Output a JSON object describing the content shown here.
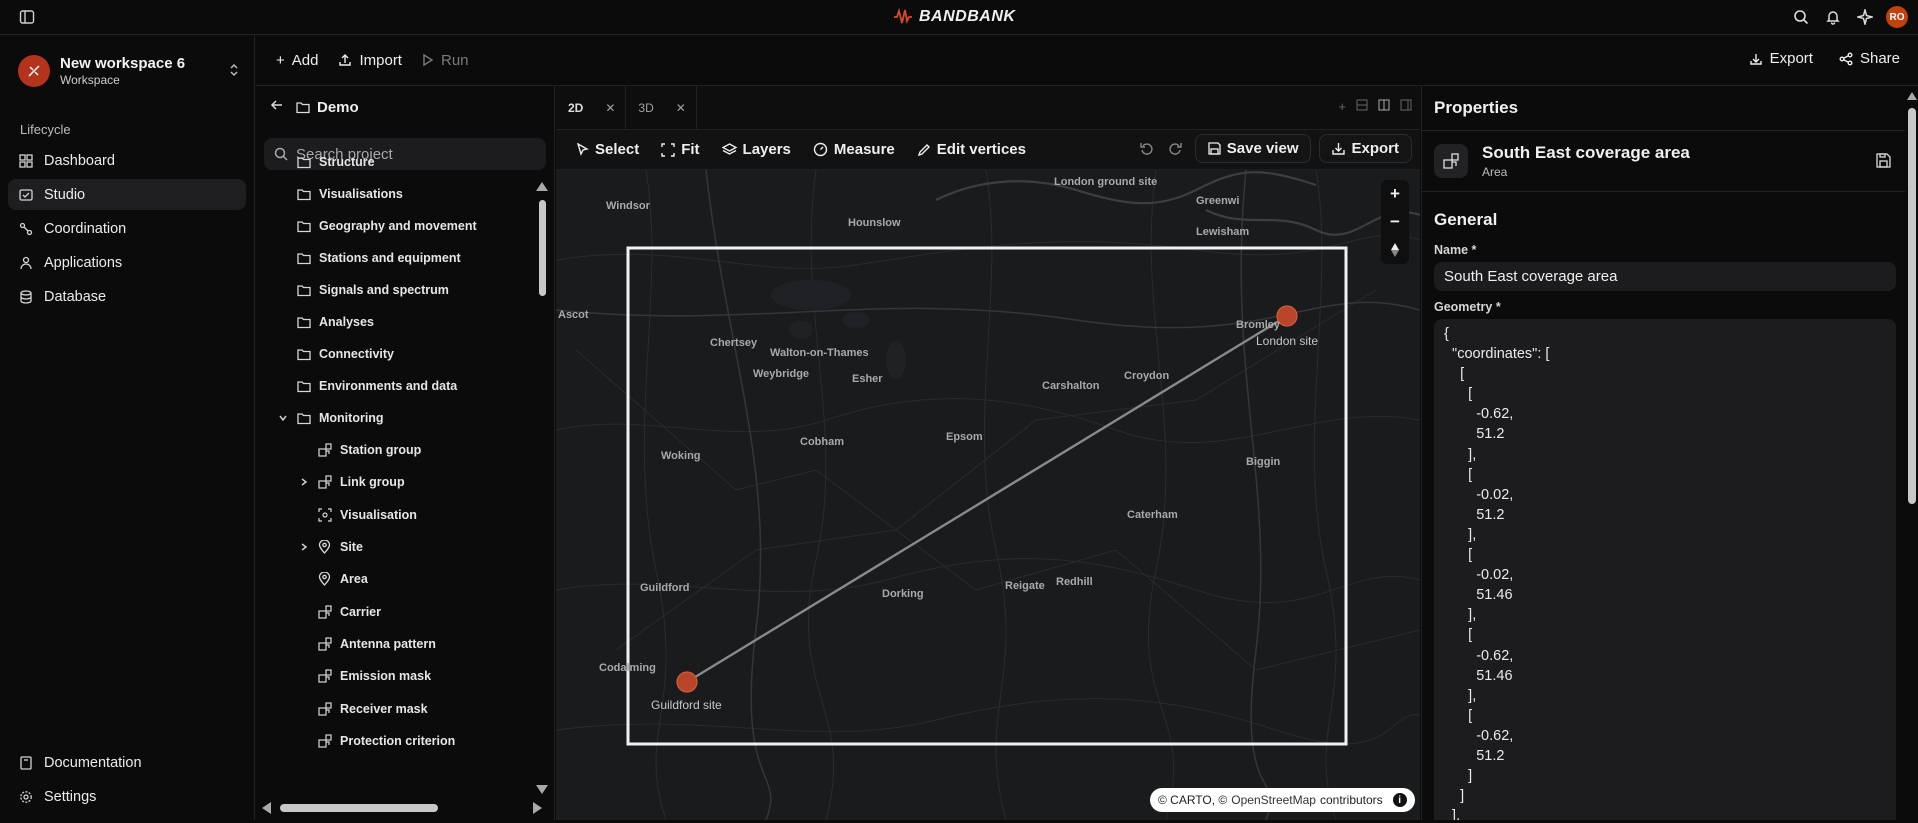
{
  "app": {
    "brand": "BANDBANK",
    "user_initials": "RO",
    "accent": "#c2410c"
  },
  "workspace": {
    "name": "New workspace 6",
    "subtitle": "Workspace"
  },
  "nav": {
    "section_label": "Lifecycle",
    "items": [
      {
        "label": "Dashboard",
        "icon": "dashboard-icon"
      },
      {
        "label": "Studio",
        "icon": "studio-icon",
        "active": true
      },
      {
        "label": "Coordination",
        "icon": "coordination-icon"
      },
      {
        "label": "Applications",
        "icon": "applications-icon"
      },
      {
        "label": "Database",
        "icon": "database-icon"
      }
    ],
    "bottom": [
      {
        "label": "Documentation",
        "icon": "book-icon"
      },
      {
        "label": "Settings",
        "icon": "gear-icon"
      }
    ]
  },
  "toolbar": {
    "add": "Add",
    "import": "Import",
    "run": "Run",
    "export": "Export",
    "share": "Share"
  },
  "tree": {
    "title": "Demo",
    "search_placeholder": "Search project",
    "rows": [
      {
        "label": "Structure",
        "indent": 0,
        "icon": "folder"
      },
      {
        "label": "Visualisations",
        "indent": 0,
        "icon": "folder"
      },
      {
        "label": "Geography and movement",
        "indent": 0,
        "icon": "folder"
      },
      {
        "label": "Stations and equipment",
        "indent": 0,
        "icon": "folder"
      },
      {
        "label": "Signals and spectrum",
        "indent": 0,
        "icon": "folder"
      },
      {
        "label": "Analyses",
        "indent": 0,
        "icon": "folder"
      },
      {
        "label": "Connectivity",
        "indent": 0,
        "icon": "folder"
      },
      {
        "label": "Environments and data",
        "indent": 0,
        "icon": "folder"
      },
      {
        "label": "Monitoring",
        "indent": 0,
        "icon": "folder",
        "expanded": true
      },
      {
        "label": "Station group",
        "indent": 1,
        "icon": "group"
      },
      {
        "label": "Link group",
        "indent": 1,
        "icon": "group",
        "collapsed": true
      },
      {
        "label": "Visualisation",
        "indent": 1,
        "icon": "visual"
      },
      {
        "label": "Site",
        "indent": 1,
        "icon": "pin",
        "collapsed": true
      },
      {
        "label": "Area",
        "indent": 1,
        "icon": "pin"
      },
      {
        "label": "Carrier",
        "indent": 1,
        "icon": "group"
      },
      {
        "label": "Antenna pattern",
        "indent": 1,
        "icon": "group"
      },
      {
        "label": "Emission mask",
        "indent": 1,
        "icon": "group"
      },
      {
        "label": "Receiver mask",
        "indent": 1,
        "icon": "group"
      },
      {
        "label": "Protection criterion",
        "indent": 1,
        "icon": "group"
      }
    ]
  },
  "map": {
    "tabs": [
      {
        "label": "2D",
        "active": true
      },
      {
        "label": "3D",
        "active": false
      }
    ],
    "tools": [
      "Select",
      "Fit",
      "Layers",
      "Measure",
      "Edit vertices"
    ],
    "save_view": "Save view",
    "export": "Export",
    "places": [
      "London ground site",
      "Windsor",
      "Hounslow",
      "Greenwi",
      "Lewisham",
      "Ascot",
      "Bromley",
      "Chertsey",
      "Walton-on-Thames",
      "Weybridge",
      "Esher",
      "Carshalton",
      "Croydon",
      "Cobham",
      "Epsom",
      "Woking",
      "Biggin",
      "Caterham",
      "Reigate",
      "Redhill",
      "Dorking",
      "Guildford",
      "Codalming"
    ],
    "sites": [
      {
        "label": "London site"
      },
      {
        "label": "Guildford site"
      }
    ],
    "attribution": {
      "carto": "© CARTO, ©",
      "osm": "OpenStreetMap",
      "contributors": "contributors"
    }
  },
  "properties": {
    "title": "Properties",
    "object_name": "South East coverage area",
    "object_type": "Area",
    "section": "General",
    "name_label": "Name *",
    "name_value": "South East coverage area",
    "geometry_label": "Geometry *",
    "geometry_text": "{\n  \"coordinates\": [\n    [\n      [\n        -0.62,\n        51.2\n      ],\n      [\n        -0.02,\n        51.2\n      ],\n      [\n        -0.02,\n        51.46\n      ],\n      [\n        -0.62,\n        51.46\n      ],\n      [\n        -0.62,\n        51.2\n      ]\n    ]\n  ],"
  }
}
